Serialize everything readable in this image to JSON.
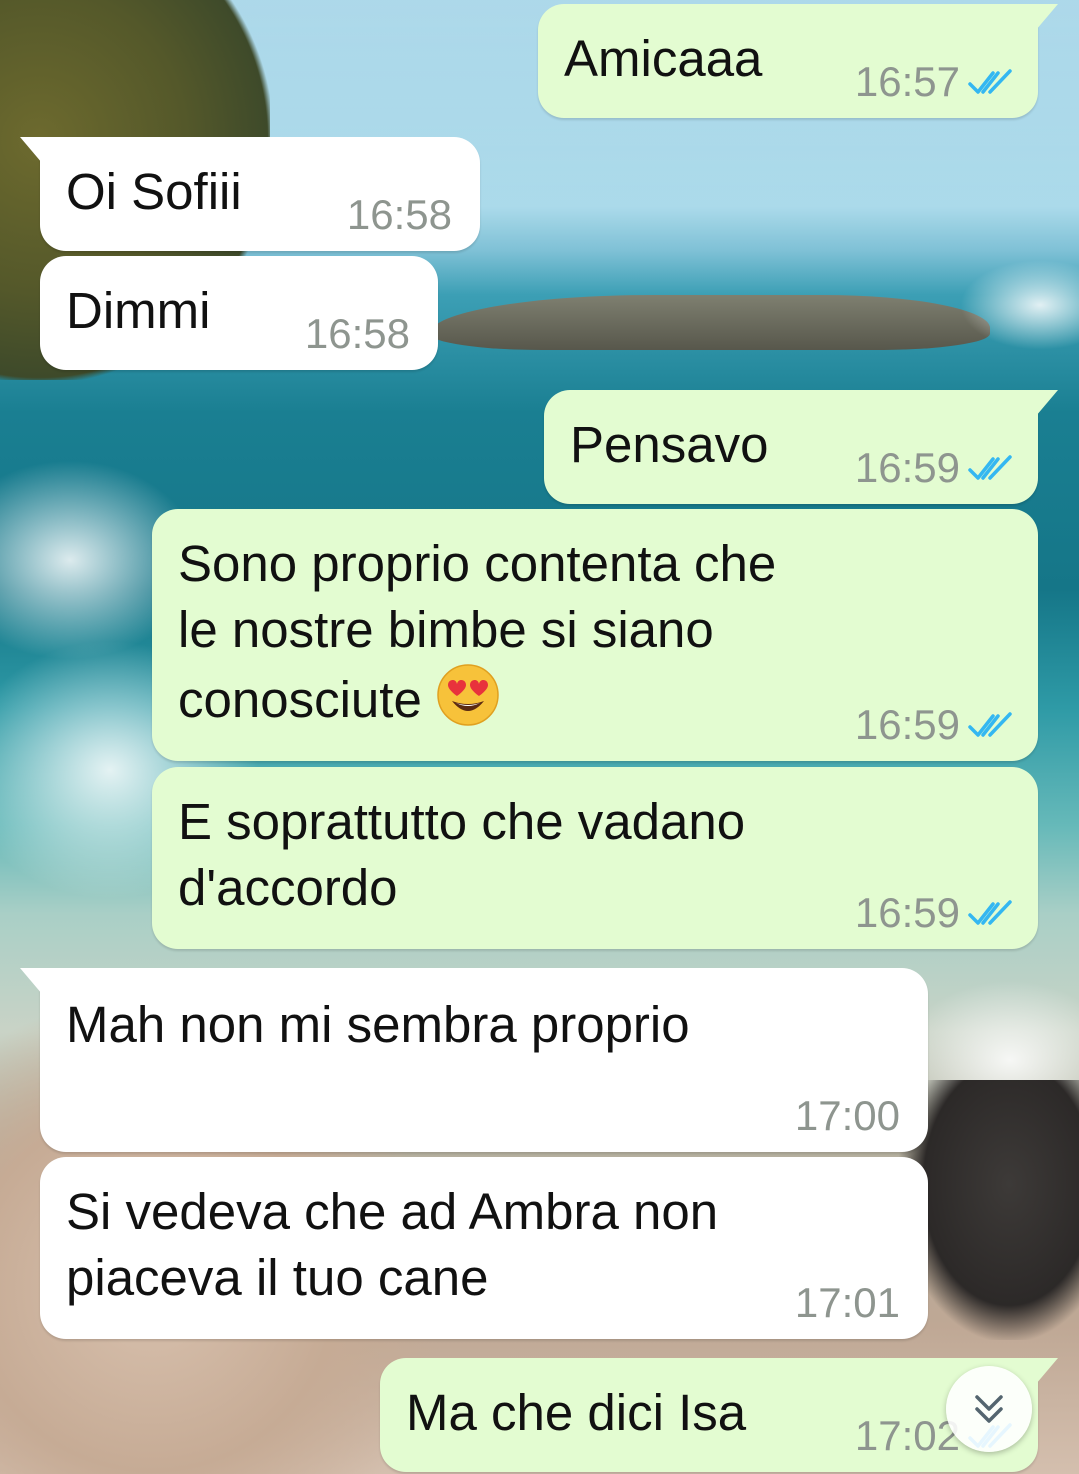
{
  "colors": {
    "outgoing_bubble": "#e3fcd1",
    "incoming_bubble": "#ffffff",
    "read_ticks": "#34b7f1",
    "timestamp": "#8e958f"
  },
  "messages": [
    {
      "direction": "outgoing",
      "lines": [
        "Amicaaa"
      ],
      "time": "16:57",
      "status": "read",
      "status_icon": "double-check-icon"
    },
    {
      "direction": "incoming",
      "lines": [
        "Oi Sofiii"
      ],
      "time": "16:58"
    },
    {
      "direction": "incoming",
      "lines": [
        "Dimmi"
      ],
      "time": "16:58"
    },
    {
      "direction": "outgoing",
      "lines": [
        "Pensavo"
      ],
      "time": "16:59",
      "status": "read",
      "status_icon": "double-check-icon"
    },
    {
      "direction": "outgoing",
      "lines": [
        "Sono proprio contenta che",
        "le nostre bimbe si siano",
        "conosciute"
      ],
      "emoji": "heart-eyes-emoji",
      "time": "16:59",
      "status": "read",
      "status_icon": "double-check-icon"
    },
    {
      "direction": "outgoing",
      "lines": [
        "E soprattutto che vadano",
        "d'accordo"
      ],
      "time": "16:59",
      "status": "read",
      "status_icon": "double-check-icon"
    },
    {
      "direction": "incoming",
      "lines": [
        "Mah non mi sembra proprio"
      ],
      "time": "17:00"
    },
    {
      "direction": "incoming",
      "lines": [
        "Si vedeva che ad Ambra non",
        "piaceva il tuo cane"
      ],
      "time": "17:01"
    },
    {
      "direction": "outgoing",
      "lines": [
        "Ma che dici Isa"
      ],
      "time": "17:02",
      "status": "read",
      "status_icon": "double-check-icon"
    }
  ],
  "scroll_to_bottom": {
    "icon": "double-chevron-down-icon"
  }
}
